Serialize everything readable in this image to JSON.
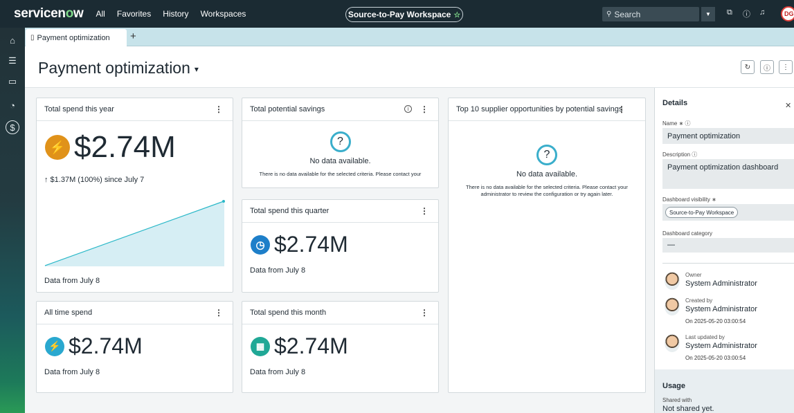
{
  "topbar": {
    "logo_pre": "servicen",
    "logo_o": "o",
    "logo_post": "w",
    "nav": [
      "All",
      "Favorites",
      "History",
      "Workspaces"
    ],
    "workspace": "Source-to-Pay Workspace",
    "search_placeholder": "Search",
    "user_initials": "DG"
  },
  "tab": {
    "label": "Payment optimization"
  },
  "page": {
    "title": "Payment optimization"
  },
  "cards": {
    "total_year": {
      "title": "Total spend this year",
      "value": "$2.74M",
      "change": "↑ $1.37M (100%) since July 7",
      "footer": "Data from July 8"
    },
    "potential_savings": {
      "title": "Total potential savings",
      "nodata_title": "No data available.",
      "nodata_desc": "There is no data available for the selected criteria. Please contact your"
    },
    "top10": {
      "title": "Top 10 supplier opportunities by potential savings",
      "nodata_title": "No data available.",
      "nodata_desc": "There is no data available for the selected criteria. Please contact your administrator to review the configuration or try again later."
    },
    "quarter": {
      "title": "Total spend this quarter",
      "value": "$2.74M",
      "footer": "Data from July 8"
    },
    "all_time": {
      "title": "All time spend",
      "value": "$2.74M",
      "footer": "Data from July 8"
    },
    "month": {
      "title": "Total spend this month",
      "value": "$2.74M",
      "footer": "Data from July 8"
    }
  },
  "colors": {
    "year_icon": "#e0921a",
    "quarter_icon": "#1e7fc9",
    "all_time_icon": "#2aa8cf",
    "month_icon": "#20a896",
    "sparkline": "#2ab8c8"
  },
  "details": {
    "title": "Details",
    "name_label": "Name ∗ ⓘ",
    "name_value": "Payment optimization",
    "description_label": "Description ⓘ",
    "description_value": "Payment optimization dashboard",
    "visibility_label": "Dashboard visibility ∗",
    "visibility_value": "Source-to-Pay Workspace",
    "category_label": "Dashboard category",
    "category_value": "—",
    "owner_label": "Owner",
    "owner_name": "System Administrator",
    "created_label": "Created by",
    "created_name": "System Administrator",
    "created_date": "On 2025-05-20 03:00:54",
    "updated_label": "Last updated by",
    "updated_name": "System Administrator",
    "updated_date": "On 2025-05-20 03:00:54",
    "usage_title": "Usage",
    "shared_label": "Shared with",
    "shared_value": "Not shared yet."
  }
}
